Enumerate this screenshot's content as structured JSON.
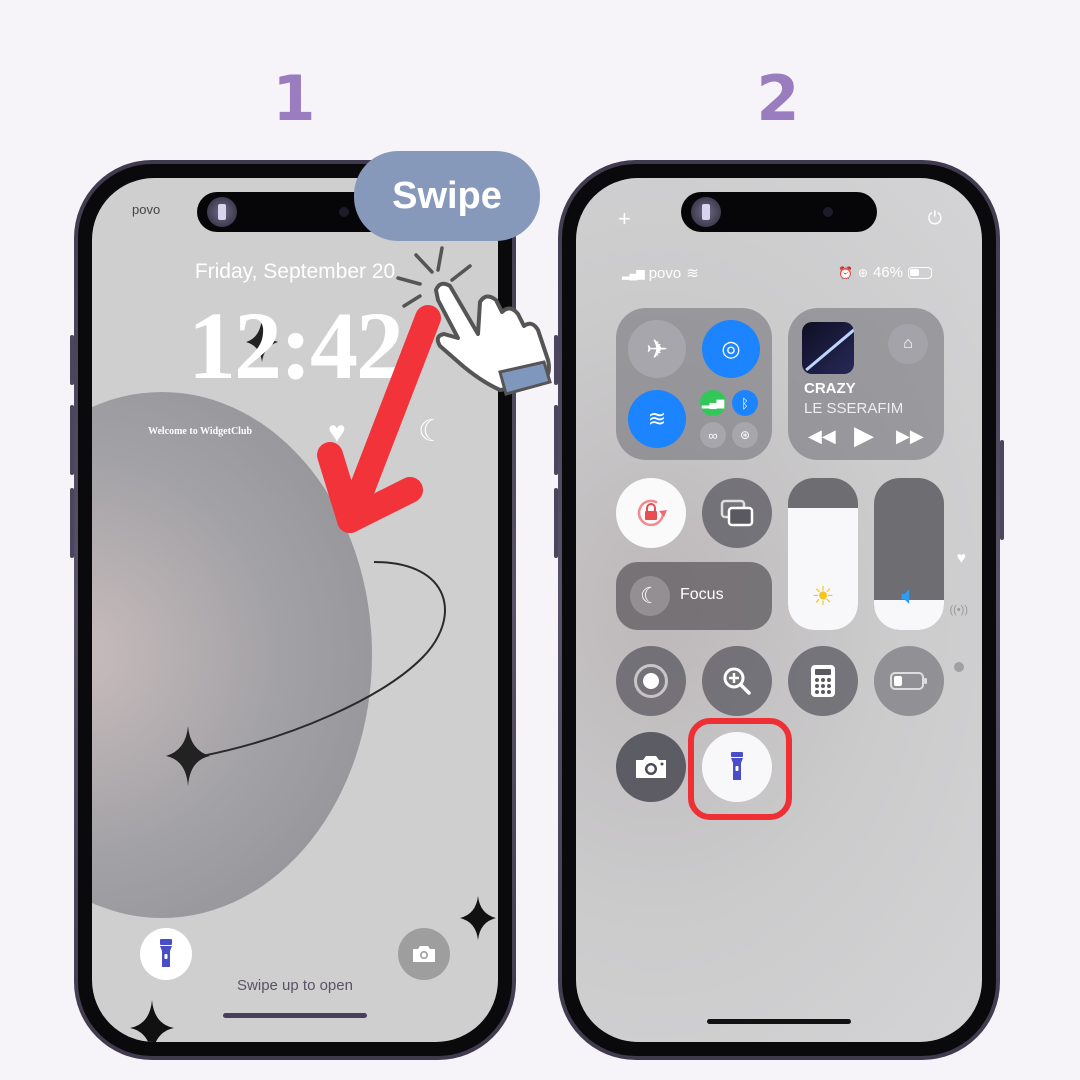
{
  "steps": [
    "1",
    "2"
  ],
  "annotation": {
    "swipe_label": "Swipe",
    "highlight_color": "#ee2f34",
    "accent_color": "#9a7dbf"
  },
  "lock_screen": {
    "carrier": "povo",
    "date": "Friday, September 20",
    "time": "12:42",
    "widget_text": "Welcome to WidgetClub",
    "swipe_hint": "Swipe up to open",
    "buttons": [
      {
        "name": "flashlight",
        "icon": "flashlight-icon"
      },
      {
        "name": "camera",
        "icon": "camera-icon"
      }
    ]
  },
  "control_center": {
    "status_bar": {
      "carrier": "povo",
      "battery": "46%"
    },
    "connectivity": [
      "airplane-mode",
      "airdrop",
      "wifi",
      "cellular-data",
      "bluetooth",
      "personal-hotspot",
      "vpn"
    ],
    "now_playing": {
      "title": "CRAZY",
      "artist": "LE SSERAFIM"
    },
    "focus_label": "Focus",
    "brightness_level": 0.8,
    "volume_level": 0.2,
    "tiles": [
      "screen-recording",
      "magnifier",
      "calculator",
      "low-power-mode",
      "camera",
      "flashlight"
    ]
  }
}
